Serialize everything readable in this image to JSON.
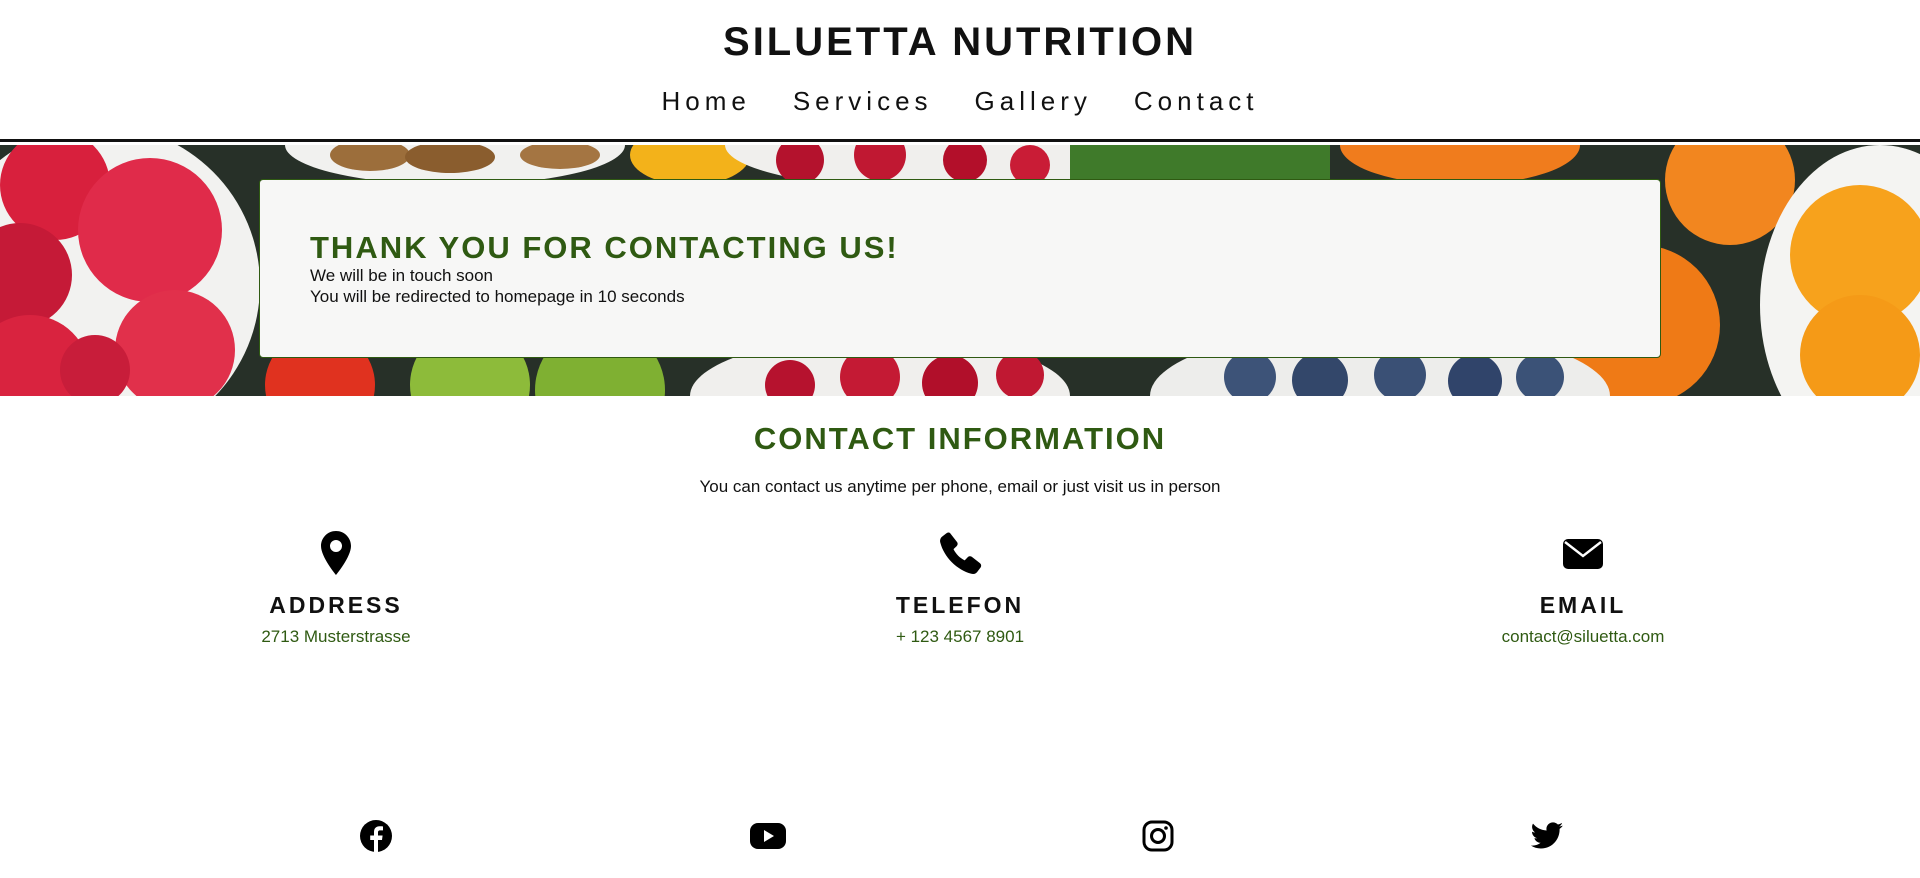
{
  "header": {
    "brand": "SILUETTA NUTRITION",
    "nav": [
      "Home",
      "Services",
      "Gallery",
      "Contact"
    ]
  },
  "hero": {
    "title": "THANK YOU FOR CONTACTING US!",
    "line1": "We will be in touch soon",
    "line2": "You will be redirected to homepage in 10 seconds"
  },
  "contact": {
    "title": "CONTACT INFORMATION",
    "subtitle": "You can contact us anytime per phone, email or just visit us in person",
    "items": [
      {
        "icon": "location-pin-icon",
        "label": "ADDRESS",
        "value": "2713 Musterstrasse"
      },
      {
        "icon": "phone-icon",
        "label": "TELEFON",
        "value": "+ 123 4567 8901"
      },
      {
        "icon": "envelope-icon",
        "label": "EMAIL",
        "value": "contact@siluetta.com"
      }
    ]
  },
  "social": [
    "facebook-icon",
    "youtube-icon",
    "instagram-icon",
    "twitter-icon"
  ],
  "colors": {
    "accent": "#2f5a12",
    "text": "#111111",
    "box_bg": "#f7f7f6"
  }
}
